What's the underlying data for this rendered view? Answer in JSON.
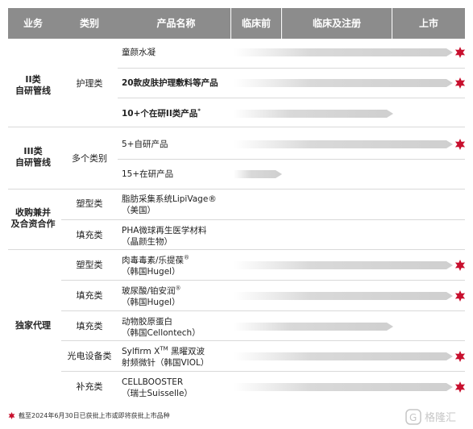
{
  "header": {
    "business": "业务",
    "category": "类别",
    "product_name": "产品名称",
    "preclinical": "临床前",
    "clinical_registration": "临床及注册",
    "launched": "上市"
  },
  "groups": [
    {
      "label": "II类\n自研管线"
    },
    {
      "label": "III类\n自研管线"
    },
    {
      "label": "收购兼并\n及合资合作"
    },
    {
      "label": "独家代理"
    }
  ],
  "categories": [
    "护理类",
    "多个类别",
    "塑型类",
    "填充类",
    "塑型类",
    "填充类",
    "填充类",
    "光电设备类",
    "补充类"
  ],
  "products": [
    {
      "line1": "童颜水凝",
      "line2": ""
    },
    {
      "line1": "20款皮肤护理敷料等产品",
      "line2": ""
    },
    {
      "line1": "10+个在研II类产品",
      "sup": "*",
      "line2": ""
    },
    {
      "line1": "5+自研产品",
      "line2": ""
    },
    {
      "line1": "15+在研产品",
      "line2": ""
    },
    {
      "line1": "脂肪采集系统LipiVage®",
      "line2": "（美国）"
    },
    {
      "line1": "PHA微球再生医学材料",
      "line2": "（晶颜生物）"
    },
    {
      "line1": "肉毒毒素/乐提葆",
      "sup": "®",
      "line2": "（韩国Hugel）"
    },
    {
      "line1": "玻尿酸/铂安润",
      "sup": "®",
      "line2": "（韩国Hugel）"
    },
    {
      "line1": "动物胶原蛋白",
      "line2": "（韩国Cellontech）"
    },
    {
      "line1": "Sylfirm X",
      "sup": "TM",
      "line1b": " 黑曜双波",
      "line2": "射频微针（韩国VIOL）"
    },
    {
      "line1": "CELLBOOSTER",
      "line2": "（瑞士Suisselle）"
    }
  ],
  "progress": [
    {
      "stage": "上市",
      "launched": true
    },
    {
      "stage": "上市",
      "launched": true
    },
    {
      "stage": "临床及注册",
      "launched": false
    },
    {
      "stage": "上市",
      "launched": true
    },
    {
      "stage": "临床前",
      "launched": false
    },
    {
      "stage": "",
      "launched": false
    },
    {
      "stage": "",
      "launched": false
    },
    {
      "stage": "上市",
      "launched": true
    },
    {
      "stage": "上市",
      "launched": true
    },
    {
      "stage": "临床及注册",
      "launched": false
    },
    {
      "stage": "上市",
      "launched": true
    },
    {
      "stage": "上市",
      "launched": true
    }
  ],
  "footnote": "截至2024年6月30日已获批上市或即将获批上市品种",
  "watermark": "格隆汇",
  "colors": {
    "header": "#8c8c8c",
    "bar": "#d9d9d9",
    "star": "#c8102e"
  }
}
